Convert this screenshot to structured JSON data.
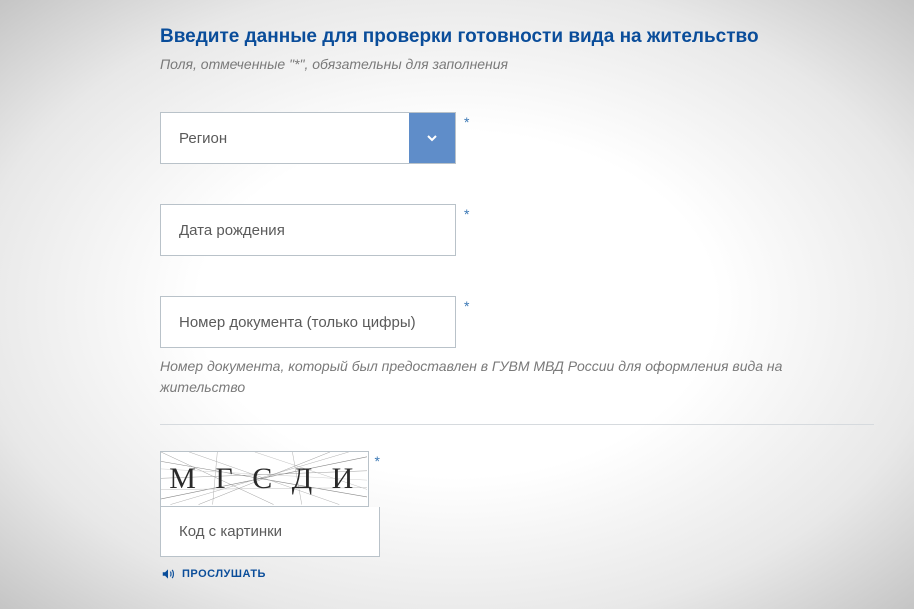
{
  "title": "Введите данные для проверки готовности вида на жительство",
  "hint": "Поля, отмеченные \"*\", обязательны для заполнения",
  "fields": {
    "region": {
      "placeholder": "Регион",
      "required": "*"
    },
    "birthdate": {
      "placeholder": "Дата рождения",
      "required": "*"
    },
    "docnumber": {
      "placeholder": "Номер документа (только цифры)",
      "required": "*",
      "description": "Номер документа, который был предоставлен в ГУВМ МВД России для оформления вида на жительство"
    }
  },
  "captcha": {
    "text": "М Г С Д И",
    "required": "*",
    "placeholder": "Код с картинки",
    "listen_label": "ПРОСЛУШАТЬ"
  }
}
